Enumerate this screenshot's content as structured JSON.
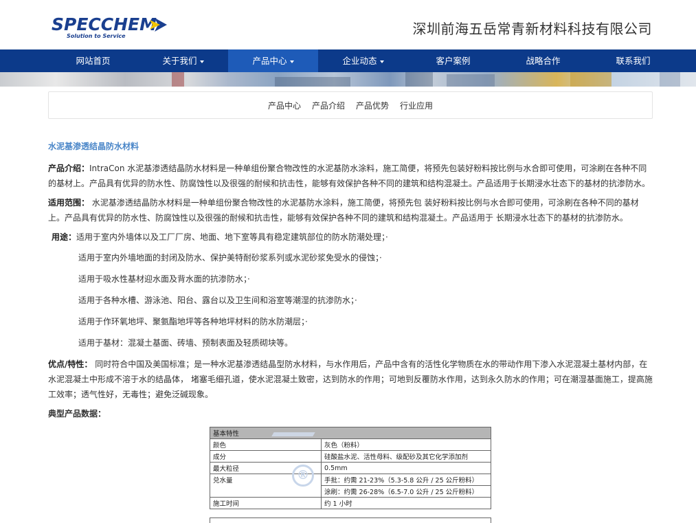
{
  "header": {
    "logo_main": "SPECCHEM",
    "logo_tagline": "Solution to Service",
    "company_name": "深圳前海五岳常青新材料科技有限公司"
  },
  "nav": {
    "items": [
      {
        "label": "网站首页"
      },
      {
        "label": "关于我们"
      },
      {
        "label": "产品中心"
      },
      {
        "label": "企业动态"
      },
      {
        "label": "客户案例"
      },
      {
        "label": "战略合作"
      },
      {
        "label": "联系我们"
      }
    ]
  },
  "subnav": {
    "items": [
      "产品中心",
      "产品介绍",
      "产品优势",
      "行业应用"
    ]
  },
  "content": {
    "title": "水泥基渗透结晶防水材料",
    "intro_label": "产品介绍：",
    "intro_text": "IntraCon 水泥基渗透结晶防水材料是一种单组份聚合物改性的水泥基防水涂料，施工简便，将预先包装好粉料按比例与水合即可使用，可涂刷在各种不同的基材上。产品具有优异的防水性、防腐蚀性以及很强的耐候和抗击性，能够有效保护各种不同的建筑和结构混凝土。产品适用于长期浸水壮态下的基材的抗渗防水。",
    "scope_label": "适用范围：",
    "scope_text": " 水泥基渗透结晶防水材料是一种单组份聚合物改性的水泥基防水涂料，施工简便，将预先包 装好粉料按比例与水合即可使用，可涂刷在各种不同的基材上。产品具有优异的防水性、防腐蚀性以及很强的耐候和抗击性，能够有效保护各种不同的建筑和结构混凝土。产品适用于 长期浸水壮态下的基材的抗渗防水。",
    "use_label": "用途：",
    "use_first": "适用于室内外墙体以及工厂厂房、地面、地下室等具有稳定建筑部位的防水防潮处理；·",
    "use_items": [
      "适用于室内外墙地面的封闭及防水、保护美特耐砂浆系列或水泥砂浆免受水的侵蚀；·",
      "适用于吸水性基材迎水面及背水面的抗渗防水；·",
      "适用于各种水槽、游泳池、阳台、露台以及卫生间和浴室等潮湿的抗渗防水；·",
      "适用于作环氧地坪、聚氨酯地坪等各种地坪材料的防水防潮层；·",
      "适用于基材：混凝土基面、砖墙、预制表面及轻质砌块等。"
    ],
    "adv_label": "优点/特性：",
    "adv_text": " 同时符合中国及美国标准；是一种水泥基渗透结晶型防水材料，与水作用后，产品中含有的活性化学物质在水的带动作用下渗入水泥混凝土基材内部，在水泥混凝土中形成不溶于水的结晶体， 堵塞毛细孔道，使水泥混凝土致密，达到防水的作用；可地到反覆防水作用，达到永久防水的作用；可在潮湿基面施工，提高施工效率；透气性好，无毒性；避免泛碱现象。",
    "typical_label": "典型产品数据："
  },
  "spec_table": {
    "header": "基本特性",
    "rows": [
      {
        "k": "颜色",
        "v": [
          "灰色（粉料）"
        ]
      },
      {
        "k": "成分",
        "v": [
          "硅酸盐水泥、活性母料、级配砂及其它化学添加剂"
        ]
      },
      {
        "k": "最大粒径",
        "v": [
          "0.5mm"
        ]
      },
      {
        "k": "兑水量",
        "v": [
          "手批：约需 21-23%（5.3-5.8 公升 / 25 公斤粉料）",
          "涂刷：约需 26-28%（6.5-7.0 公升 / 25 公斤粉料）"
        ]
      },
      {
        "k": "施工时间",
        "v": [
          "约 1 小时"
        ]
      }
    ],
    "watermark": "®"
  },
  "colors": {
    "nav_bg": "#0c3a8a",
    "nav_active": "#1e5bb8",
    "title_blue": "#4a86c8",
    "logo_blue": "#1a3f8f",
    "logo_yellow": "#f2c400"
  }
}
